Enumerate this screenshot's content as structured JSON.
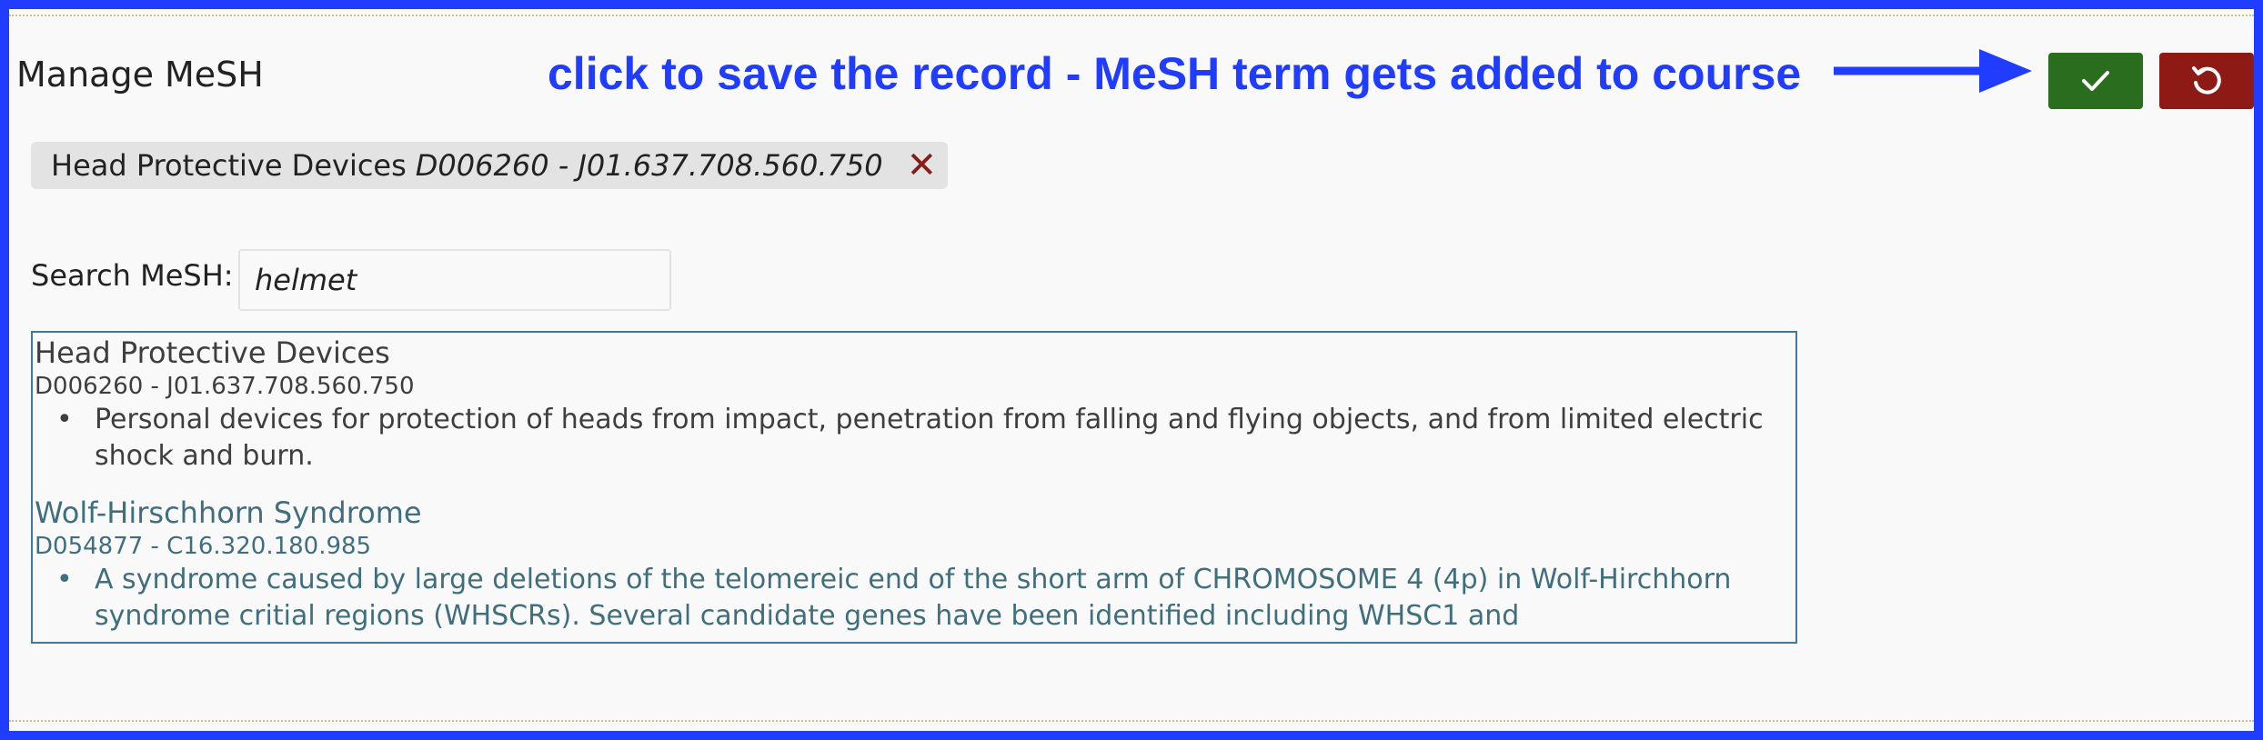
{
  "page": {
    "title": "Manage MeSH"
  },
  "annotation": {
    "text": "click to save the record - MeSH term gets added to course"
  },
  "toolbar": {
    "save_icon": "check-icon",
    "cancel_icon": "undo-icon",
    "colors": {
      "save": "#2a6d1f",
      "cancel": "#8e1a16",
      "annotation": "#1f3cff"
    }
  },
  "selected_term": {
    "name": "Head Protective Devices",
    "code": "D006260 - J01.637.708.560.750",
    "remove_symbol": "✕"
  },
  "search": {
    "label": "Search MeSH:",
    "value": "helmet"
  },
  "results": [
    {
      "title": "Head Protective Devices",
      "code": "D006260 - J01.637.708.560.750",
      "bullet": "•",
      "description": "Personal devices for protection of heads from impact, penetration from falling and flying objects, and from limited electric shock and burn."
    },
    {
      "title": "Wolf-Hirschhorn Syndrome",
      "code": "D054877 - C16.320.180.985",
      "bullet": "•",
      "description": "A syndrome caused by large deletions of the telomereic end of the short arm of CHROMOSOME 4 (4p) in Wolf-Hirchhorn syndrome critial regions (WHSCRs). Several candidate genes have been identified including WHSC1 and"
    }
  ]
}
